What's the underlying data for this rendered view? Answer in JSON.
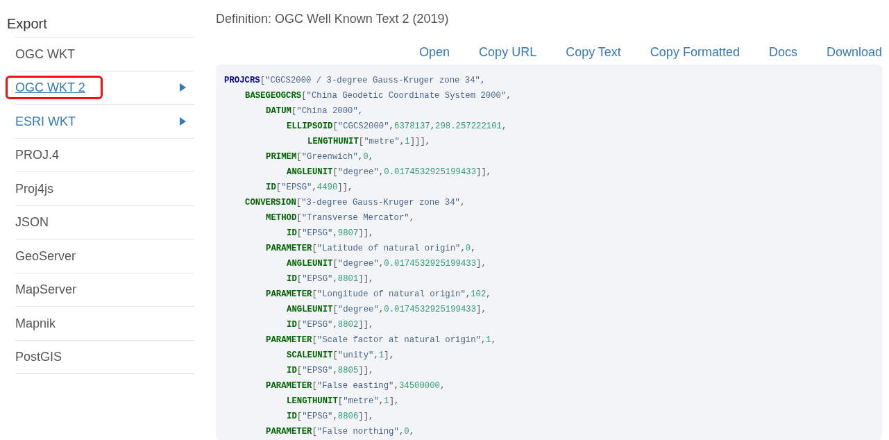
{
  "sidebar": {
    "title": "Export",
    "items": [
      {
        "label": "OGC WKT",
        "link": false,
        "arrow": false,
        "selected": false
      },
      {
        "label": "OGC WKT 2",
        "link": true,
        "arrow": true,
        "selected": true
      },
      {
        "label": "ESRI WKT",
        "link": true,
        "arrow": true,
        "selected": false
      },
      {
        "label": "PROJ.4",
        "link": false,
        "arrow": false,
        "selected": false
      },
      {
        "label": "Proj4js",
        "link": false,
        "arrow": false,
        "selected": false
      },
      {
        "label": "JSON",
        "link": false,
        "arrow": false,
        "selected": false
      },
      {
        "label": "GeoServer",
        "link": false,
        "arrow": false,
        "selected": false
      },
      {
        "label": "MapServer",
        "link": false,
        "arrow": false,
        "selected": false
      },
      {
        "label": "Mapnik",
        "link": false,
        "arrow": false,
        "selected": false
      },
      {
        "label": "PostGIS",
        "link": false,
        "arrow": false,
        "selected": false
      }
    ]
  },
  "definition": {
    "title": "Definition: OGC Well Known Text 2 (2019)",
    "actions": [
      "Open",
      "Copy URL",
      "Copy Text",
      "Copy Formatted",
      "Docs",
      "Download"
    ],
    "code": [
      {
        "tokens": [
          {
            "kind": "root",
            "text": "PROJCRS"
          },
          {
            "kind": "punct",
            "text": "["
          },
          {
            "kind": "string",
            "text": "\"CGCS2000 / 3-degree Gauss-Kruger zone 34\""
          },
          {
            "kind": "punct",
            "text": ","
          }
        ],
        "children": [
          {
            "tokens": [
              {
                "kind": "keyword",
                "text": "BASEGEOGCRS"
              },
              {
                "kind": "punct",
                "text": "["
              },
              {
                "kind": "string",
                "text": "\"China Geodetic Coordinate System 2000\""
              },
              {
                "kind": "punct",
                "text": ","
              }
            ],
            "children": [
              {
                "tokens": [
                  {
                    "kind": "keyword",
                    "text": "DATUM"
                  },
                  {
                    "kind": "punct",
                    "text": "["
                  },
                  {
                    "kind": "string",
                    "text": "\"China 2000\""
                  },
                  {
                    "kind": "punct",
                    "text": ","
                  }
                ],
                "children": [
                  {
                    "tokens": [
                      {
                        "kind": "keyword",
                        "text": "ELLIPSOID"
                      },
                      {
                        "kind": "punct",
                        "text": "["
                      },
                      {
                        "kind": "string",
                        "text": "\"CGCS2000\""
                      },
                      {
                        "kind": "punct",
                        "text": ","
                      },
                      {
                        "kind": "number",
                        "text": "6378137"
                      },
                      {
                        "kind": "punct",
                        "text": ","
                      },
                      {
                        "kind": "number",
                        "text": "298.257222101"
                      },
                      {
                        "kind": "punct",
                        "text": ","
                      }
                    ],
                    "children": [
                      {
                        "tokens": [
                          {
                            "kind": "keyword",
                            "text": "LENGTHUNIT"
                          },
                          {
                            "kind": "punct",
                            "text": "["
                          },
                          {
                            "kind": "string",
                            "text": "\"metre\""
                          },
                          {
                            "kind": "punct",
                            "text": ","
                          },
                          {
                            "kind": "number",
                            "text": "1"
                          },
                          {
                            "kind": "punct",
                            "text": "]]],"
                          }
                        ]
                      }
                    ]
                  }
                ]
              },
              {
                "tokens": [
                  {
                    "kind": "keyword",
                    "text": "PRIMEM"
                  },
                  {
                    "kind": "punct",
                    "text": "["
                  },
                  {
                    "kind": "string",
                    "text": "\"Greenwich\""
                  },
                  {
                    "kind": "punct",
                    "text": ","
                  },
                  {
                    "kind": "number",
                    "text": "0"
                  },
                  {
                    "kind": "punct",
                    "text": ","
                  }
                ],
                "children": [
                  {
                    "tokens": [
                      {
                        "kind": "keyword",
                        "text": "ANGLEUNIT"
                      },
                      {
                        "kind": "punct",
                        "text": "["
                      },
                      {
                        "kind": "string",
                        "text": "\"degree\""
                      },
                      {
                        "kind": "punct",
                        "text": ","
                      },
                      {
                        "kind": "number",
                        "text": "0.0174532925199433"
                      },
                      {
                        "kind": "punct",
                        "text": "]],"
                      }
                    ]
                  }
                ]
              },
              {
                "tokens": [
                  {
                    "kind": "keyword",
                    "text": "ID"
                  },
                  {
                    "kind": "punct",
                    "text": "["
                  },
                  {
                    "kind": "string",
                    "text": "\"EPSG\""
                  },
                  {
                    "kind": "punct",
                    "text": ","
                  },
                  {
                    "kind": "number",
                    "text": "4490"
                  },
                  {
                    "kind": "punct",
                    "text": "]],"
                  }
                ]
              }
            ]
          },
          {
            "tokens": [
              {
                "kind": "keyword",
                "text": "CONVERSION"
              },
              {
                "kind": "punct",
                "text": "["
              },
              {
                "kind": "string",
                "text": "\"3-degree Gauss-Kruger zone 34\""
              },
              {
                "kind": "punct",
                "text": ","
              }
            ],
            "children": [
              {
                "tokens": [
                  {
                    "kind": "keyword",
                    "text": "METHOD"
                  },
                  {
                    "kind": "punct",
                    "text": "["
                  },
                  {
                    "kind": "string",
                    "text": "\"Transverse Mercator\""
                  },
                  {
                    "kind": "punct",
                    "text": ","
                  }
                ],
                "children": [
                  {
                    "tokens": [
                      {
                        "kind": "keyword",
                        "text": "ID"
                      },
                      {
                        "kind": "punct",
                        "text": "["
                      },
                      {
                        "kind": "string",
                        "text": "\"EPSG\""
                      },
                      {
                        "kind": "punct",
                        "text": ","
                      },
                      {
                        "kind": "number",
                        "text": "9807"
                      },
                      {
                        "kind": "punct",
                        "text": "]],"
                      }
                    ]
                  }
                ]
              },
              {
                "tokens": [
                  {
                    "kind": "keyword",
                    "text": "PARAMETER"
                  },
                  {
                    "kind": "punct",
                    "text": "["
                  },
                  {
                    "kind": "string",
                    "text": "\"Latitude of natural origin\""
                  },
                  {
                    "kind": "punct",
                    "text": ","
                  },
                  {
                    "kind": "number",
                    "text": "0"
                  },
                  {
                    "kind": "punct",
                    "text": ","
                  }
                ],
                "children": [
                  {
                    "tokens": [
                      {
                        "kind": "keyword",
                        "text": "ANGLEUNIT"
                      },
                      {
                        "kind": "punct",
                        "text": "["
                      },
                      {
                        "kind": "string",
                        "text": "\"degree\""
                      },
                      {
                        "kind": "punct",
                        "text": ","
                      },
                      {
                        "kind": "number",
                        "text": "0.0174532925199433"
                      },
                      {
                        "kind": "punct",
                        "text": "],"
                      }
                    ]
                  },
                  {
                    "tokens": [
                      {
                        "kind": "keyword",
                        "text": "ID"
                      },
                      {
                        "kind": "punct",
                        "text": "["
                      },
                      {
                        "kind": "string",
                        "text": "\"EPSG\""
                      },
                      {
                        "kind": "punct",
                        "text": ","
                      },
                      {
                        "kind": "number",
                        "text": "8801"
                      },
                      {
                        "kind": "punct",
                        "text": "]],"
                      }
                    ]
                  }
                ]
              },
              {
                "tokens": [
                  {
                    "kind": "keyword",
                    "text": "PARAMETER"
                  },
                  {
                    "kind": "punct",
                    "text": "["
                  },
                  {
                    "kind": "string",
                    "text": "\"Longitude of natural origin\""
                  },
                  {
                    "kind": "punct",
                    "text": ","
                  },
                  {
                    "kind": "number",
                    "text": "102"
                  },
                  {
                    "kind": "punct",
                    "text": ","
                  }
                ],
                "children": [
                  {
                    "tokens": [
                      {
                        "kind": "keyword",
                        "text": "ANGLEUNIT"
                      },
                      {
                        "kind": "punct",
                        "text": "["
                      },
                      {
                        "kind": "string",
                        "text": "\"degree\""
                      },
                      {
                        "kind": "punct",
                        "text": ","
                      },
                      {
                        "kind": "number",
                        "text": "0.0174532925199433"
                      },
                      {
                        "kind": "punct",
                        "text": "],"
                      }
                    ]
                  },
                  {
                    "tokens": [
                      {
                        "kind": "keyword",
                        "text": "ID"
                      },
                      {
                        "kind": "punct",
                        "text": "["
                      },
                      {
                        "kind": "string",
                        "text": "\"EPSG\""
                      },
                      {
                        "kind": "punct",
                        "text": ","
                      },
                      {
                        "kind": "number",
                        "text": "8802"
                      },
                      {
                        "kind": "punct",
                        "text": "]],"
                      }
                    ]
                  }
                ]
              },
              {
                "tokens": [
                  {
                    "kind": "keyword",
                    "text": "PARAMETER"
                  },
                  {
                    "kind": "punct",
                    "text": "["
                  },
                  {
                    "kind": "string",
                    "text": "\"Scale factor at natural origin\""
                  },
                  {
                    "kind": "punct",
                    "text": ","
                  },
                  {
                    "kind": "number",
                    "text": "1"
                  },
                  {
                    "kind": "punct",
                    "text": ","
                  }
                ],
                "children": [
                  {
                    "tokens": [
                      {
                        "kind": "keyword",
                        "text": "SCALEUNIT"
                      },
                      {
                        "kind": "punct",
                        "text": "["
                      },
                      {
                        "kind": "string",
                        "text": "\"unity\""
                      },
                      {
                        "kind": "punct",
                        "text": ","
                      },
                      {
                        "kind": "number",
                        "text": "1"
                      },
                      {
                        "kind": "punct",
                        "text": "],"
                      }
                    ]
                  },
                  {
                    "tokens": [
                      {
                        "kind": "keyword",
                        "text": "ID"
                      },
                      {
                        "kind": "punct",
                        "text": "["
                      },
                      {
                        "kind": "string",
                        "text": "\"EPSG\""
                      },
                      {
                        "kind": "punct",
                        "text": ","
                      },
                      {
                        "kind": "number",
                        "text": "8805"
                      },
                      {
                        "kind": "punct",
                        "text": "]],"
                      }
                    ]
                  }
                ]
              },
              {
                "tokens": [
                  {
                    "kind": "keyword",
                    "text": "PARAMETER"
                  },
                  {
                    "kind": "punct",
                    "text": "["
                  },
                  {
                    "kind": "string",
                    "text": "\"False easting\""
                  },
                  {
                    "kind": "punct",
                    "text": ","
                  },
                  {
                    "kind": "number",
                    "text": "34500000"
                  },
                  {
                    "kind": "punct",
                    "text": ","
                  }
                ],
                "children": [
                  {
                    "tokens": [
                      {
                        "kind": "keyword",
                        "text": "LENGTHUNIT"
                      },
                      {
                        "kind": "punct",
                        "text": "["
                      },
                      {
                        "kind": "string",
                        "text": "\"metre\""
                      },
                      {
                        "kind": "punct",
                        "text": ","
                      },
                      {
                        "kind": "number",
                        "text": "1"
                      },
                      {
                        "kind": "punct",
                        "text": "],"
                      }
                    ]
                  },
                  {
                    "tokens": [
                      {
                        "kind": "keyword",
                        "text": "ID"
                      },
                      {
                        "kind": "punct",
                        "text": "["
                      },
                      {
                        "kind": "string",
                        "text": "\"EPSG\""
                      },
                      {
                        "kind": "punct",
                        "text": ","
                      },
                      {
                        "kind": "number",
                        "text": "8806"
                      },
                      {
                        "kind": "punct",
                        "text": "]],"
                      }
                    ]
                  }
                ]
              },
              {
                "tokens": [
                  {
                    "kind": "keyword",
                    "text": "PARAMETER"
                  },
                  {
                    "kind": "punct",
                    "text": "["
                  },
                  {
                    "kind": "string",
                    "text": "\"False northing\""
                  },
                  {
                    "kind": "punct",
                    "text": ","
                  },
                  {
                    "kind": "number",
                    "text": "0"
                  },
                  {
                    "kind": "punct",
                    "text": ","
                  }
                ]
              }
            ]
          }
        ]
      }
    ]
  }
}
